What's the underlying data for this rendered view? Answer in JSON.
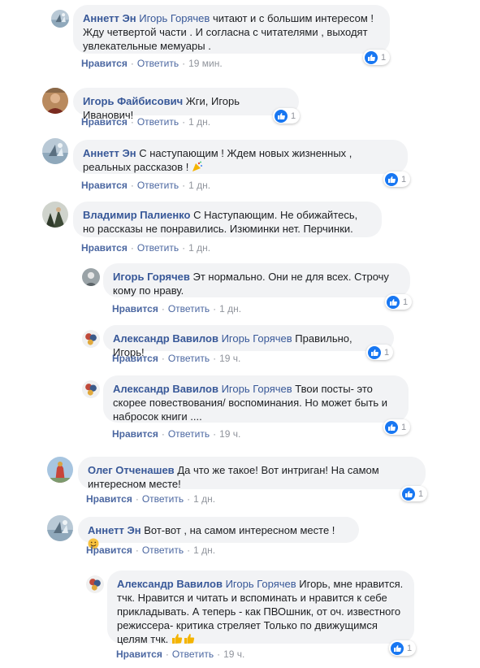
{
  "comments": [
    {
      "author": "Аннетт Эн",
      "tag": "Игорь Горячев",
      "text": "читают и с большим интересом ! Жду четвертой части . И согласна с читателями , выходят увлекательные мемуары .",
      "like": "Нравится",
      "reply": "Ответить",
      "time": "19 мин.",
      "likes": "1"
    },
    {
      "author": "Игорь Файбисович",
      "tag": "",
      "text": "Жги, Игорь Иванович!",
      "like": "Нравится",
      "reply": "Ответить",
      "time": "1 дн.",
      "likes": "1"
    },
    {
      "author": "Аннетт Эн",
      "tag": "",
      "text": "С наступающим ! Ждем новых жизненных , реальных рассказов !",
      "like": "Нравится",
      "reply": "Ответить",
      "time": "1 дн.",
      "likes": "1"
    },
    {
      "author": "Владимир Палиенко",
      "tag": "",
      "text": "С Наступающим. Не обижайтесь, но рассказы не понравились. Изюминки нет. Перчинки.",
      "like": "Нравится",
      "reply": "Ответить",
      "time": "1 дн.",
      "likes": ""
    },
    {
      "author": "Игорь Горячев",
      "tag": "",
      "text": "Эт нормально. Они не для всех. Строчу кому по нраву.",
      "like": "Нравится",
      "reply": "Ответить",
      "time": "1 дн.",
      "likes": "1"
    },
    {
      "author": "Александр Вавилов",
      "tag": "Игорь Горячев",
      "text": "Правильно, Игорь!",
      "like": "Нравится",
      "reply": "Ответить",
      "time": "19 ч.",
      "likes": "1"
    },
    {
      "author": "Александр Вавилов",
      "tag": "Игорь Горячев",
      "text": "Твои посты- это скорее повествования/ воспоминания. Но может быть и набросок книги ....",
      "like": "Нравится",
      "reply": "Ответить",
      "time": "19 ч.",
      "likes": "1"
    },
    {
      "author": "Олег Отченашев",
      "tag": "",
      "text": "Да что же такое! Вот интриган! На самом интересном месте!",
      "like": "Нравится",
      "reply": "Ответить",
      "time": "1 дн.",
      "likes": "1"
    },
    {
      "author": "Аннетт Эн",
      "tag": "",
      "text": "Вот-вот , на самом интересном месте !",
      "like": "Нравится",
      "reply": "Ответить",
      "time": "1 дн.",
      "likes": ""
    },
    {
      "author": "Александр Вавилов",
      "tag": "Игорь Горячев",
      "text": "Игорь, мне нравится. тчк. Нравится и читать и вспоминать и нравится к себе прикладывать. А теперь - как ПВОшник, от оч. известного режиссера- критика стреляет Только по движущимся целям тчк.",
      "like": "Нравится",
      "reply": "Ответить",
      "time": "19 ч.",
      "likes": "1"
    }
  ],
  "colors": {
    "link": "#385898",
    "bubble": "#f2f3f5",
    "like_badge": "#1877f2",
    "meta": "#90949c"
  }
}
